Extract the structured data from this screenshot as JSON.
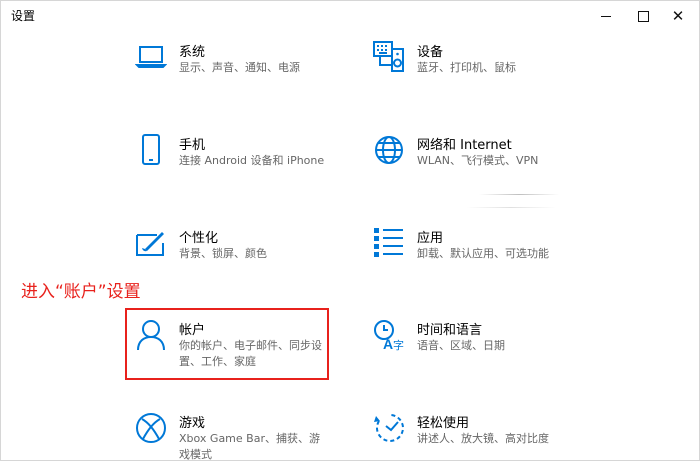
{
  "window": {
    "title": "设置"
  },
  "controls": {
    "minimize_icon": "minimize-icon",
    "maximize_icon": "maximize-icon",
    "close_icon": "close-icon",
    "close_glyph": "✕"
  },
  "accent": "#0078d7",
  "annotation": {
    "text": "进入“账户”设置",
    "color": "#e8211c"
  },
  "items": [
    {
      "id": "system",
      "icon": "laptop-icon",
      "title": "系统",
      "desc": "显示、声音、通知、电源"
    },
    {
      "id": "devices",
      "icon": "keyboard-speaker-icon",
      "title": "设备",
      "desc": "蓝牙、打印机、鼠标"
    },
    {
      "id": "phone",
      "icon": "phone-icon",
      "title": "手机",
      "desc": "连接 Android 设备和 iPhone"
    },
    {
      "id": "network",
      "icon": "globe-icon",
      "title": "网络和 Internet",
      "desc": "WLAN、飞行模式、VPN"
    },
    {
      "id": "personalization",
      "icon": "paint-icon",
      "title": "个性化",
      "desc": "背景、锁屏、颜色"
    },
    {
      "id": "apps",
      "icon": "app-list-icon",
      "title": "应用",
      "desc": "卸载、默认应用、可选功能"
    },
    {
      "id": "accounts",
      "icon": "person-icon",
      "title": "帐户",
      "desc": "你的帐户、电子邮件、同步设置、工作、家庭"
    },
    {
      "id": "time-language",
      "icon": "time-language-icon",
      "title": "时间和语言",
      "desc": "语音、区域、日期"
    },
    {
      "id": "gaming",
      "icon": "xbox-icon",
      "title": "游戏",
      "desc": "Xbox Game Bar、捕获、游戏模式"
    },
    {
      "id": "ease-of-access",
      "icon": "ease-of-access-icon",
      "title": "轻松使用",
      "desc": "讲述人、放大镜、高对比度"
    }
  ]
}
